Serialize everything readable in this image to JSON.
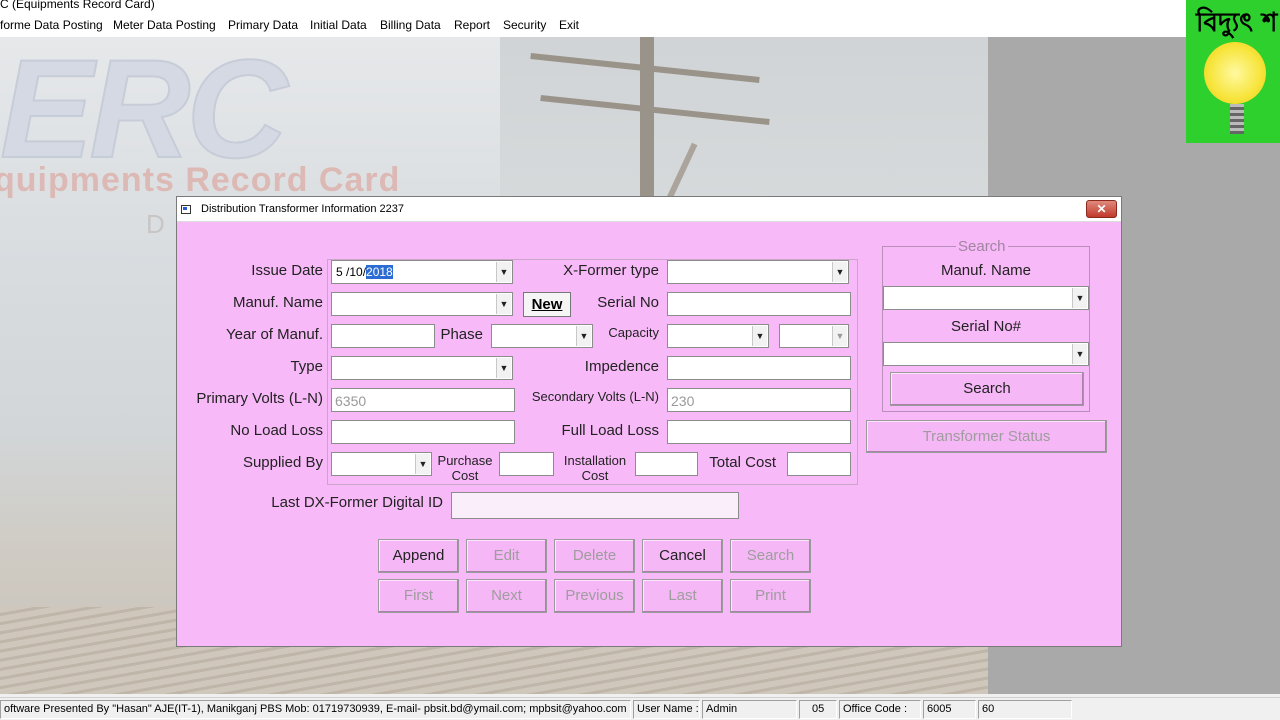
{
  "window": {
    "title": "C (Equipments Record Card)"
  },
  "menu": [
    "forme Data Posting",
    "Meter Data Posting",
    "Primary Data",
    "Initial Data",
    "Billing Data",
    "Report",
    "Security",
    "Exit"
  ],
  "background": {
    "logo": "ERC",
    "subtitle": "quipments Record Card",
    "fragment": "D"
  },
  "brand_logo": {
    "text": "বিদ্যুৎ শ"
  },
  "dialog": {
    "title": "Distribution Transformer Information 2237",
    "close_icon": "close-icon",
    "labels": {
      "issue_date": "Issue Date",
      "xformer_type": "X-Former type",
      "manuf_name": "Manuf. Name",
      "serial_no": "Serial No",
      "year_of_manuf": "Year of Manuf.",
      "phase": "Phase",
      "capacity": "Capacity",
      "type": "Type",
      "impedence": "Impedence",
      "primary_volts": "Primary Volts (L-N)",
      "secondary_volts": "Secondary Volts (L-N)",
      "no_load_loss": "No Load Loss",
      "full_load_loss": "Full Load Loss",
      "supplied_by": "Supplied By",
      "purchase_cost_1": "Purchase",
      "purchase_cost_2": "Cost",
      "installation_cost_1": "Installation",
      "installation_cost_2": "Cost",
      "total_cost": "Total Cost",
      "last_dx": "Last DX-Former Digital ID"
    },
    "values": {
      "issue_date_prefix": "5 /10/",
      "issue_date_selected": "2018",
      "primary_volts": "6350",
      "secondary_volts": "230"
    },
    "new_button": "New",
    "buttons_row1": [
      {
        "label": "Append",
        "enabled": true
      },
      {
        "label": "Edit",
        "enabled": false
      },
      {
        "label": "Delete",
        "enabled": false
      },
      {
        "label": "Cancel",
        "enabled": true
      },
      {
        "label": "Search",
        "enabled": false
      }
    ],
    "buttons_row2": [
      {
        "label": "First",
        "enabled": false
      },
      {
        "label": "Next",
        "enabled": false
      },
      {
        "label": "Previous",
        "enabled": false
      },
      {
        "label": "Last",
        "enabled": false
      },
      {
        "label": "Print",
        "enabled": false
      }
    ],
    "search_panel": {
      "legend": "Search",
      "manuf_name_label": "Manuf. Name",
      "serial_label": "Serial No#",
      "search_button": "Search",
      "status_button": "Transformer Status"
    }
  },
  "statusbar": {
    "credits": "oftware Presented By \"Hasan\" AJE(IT-1), Manikganj PBS Mob: 01719730939, E-mail- pbsit.bd@ymail.com; mpbsit@yahoo.com",
    "user_label": "User Name :",
    "user_value": "Admin",
    "code1": "05",
    "office_label": "Office Code :",
    "office_value": "6005",
    "code2": "60"
  }
}
